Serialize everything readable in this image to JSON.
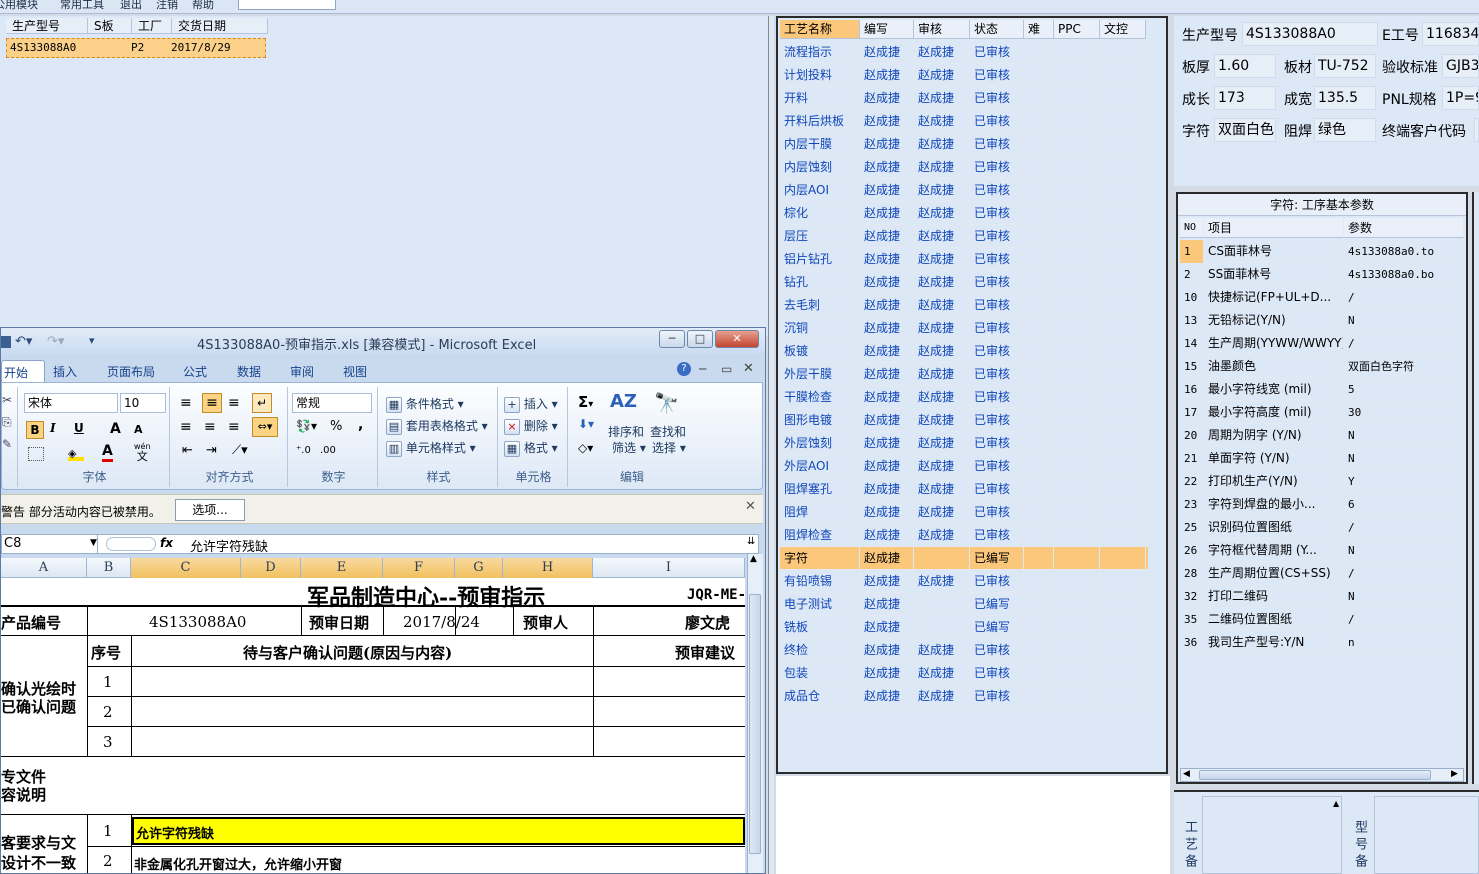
{
  "menubar": {
    "items": [
      "公用模块",
      "常用工具",
      "退出",
      "注销",
      "帮助"
    ]
  },
  "orders": {
    "headers": [
      "生产型号",
      "S板",
      "工厂",
      "交货日期"
    ],
    "rows": [
      {
        "model": "4S133088A0",
        "s_board": "",
        "factory": "P2",
        "date": "2017/8/29"
      }
    ]
  },
  "excel": {
    "title": "4S133088A0-预审指示.xls  [兼容模式] - Microsoft Excel",
    "tabs": [
      "开始",
      "插入",
      "页面布局",
      "公式",
      "数据",
      "审阅",
      "视图"
    ],
    "ribbon": {
      "font_name": "宋体",
      "font_size": "10",
      "number_format": "常规",
      "bold": "B",
      "italic": "I",
      "underline": "U",
      "font_grow": "A",
      "font_shrink": "A",
      "font_color": "A",
      "wen": "wén",
      "wen_char": "文",
      "percent": "%",
      "comma": ",",
      "sigma": "Σ",
      "conditional_format": "条件格式",
      "table_format": "套用表格格式",
      "cell_style": "单元格样式",
      "insert": "插入",
      "delete": "删除",
      "format": "格式",
      "sort": "排序和",
      "filter": "筛选",
      "find": "查找和",
      "select": "选择",
      "groups": [
        "字体",
        "对齐方式",
        "数字",
        "样式",
        "单元格",
        "编辑"
      ]
    },
    "security": {
      "warning": "警告   部分活动内容已被禁用。",
      "options": "选项..."
    },
    "namebox": "C8",
    "fx": "fx",
    "formula": "允许字符残缺",
    "columns": [
      "A",
      "B",
      "C",
      "D",
      "E",
      "F",
      "G",
      "H",
      "I"
    ],
    "sheet": {
      "title": "军品制造中心--预审指示",
      "code": "JQR-ME-",
      "product_label": "产品编号",
      "product_value": "4S133088A0",
      "date_label": "预审日期",
      "date_value": "2017/8/24",
      "reviewer_label": "预审人",
      "reviewer_value": "廖文虎",
      "seq_header": "序号",
      "issue_header": "待与客户确认问题(原因与内容)",
      "suggest_header": "预审建议",
      "section1_label_1": "确认光绘时",
      "section1_label_2": "已确认问题",
      "rows1": [
        "1",
        "2",
        "3"
      ],
      "section2_label_1": "专文件",
      "section2_label_2": "容说明",
      "section3_label_1": "客要求与文",
      "section3_label_2": "设计不一致",
      "row3_1_no": "1",
      "row3_1_text": "允许字符残缺",
      "row3_2_no": "2",
      "row3_2_text": "非金属化孔开窗过大，允许缩小开窗"
    }
  },
  "process": {
    "headers": [
      "工艺名称",
      "编写",
      "审核",
      "状态",
      "难",
      "PPC",
      "文控"
    ],
    "rows": [
      {
        "name": "流程指示",
        "writer": "赵成捷",
        "reviewer": "赵成捷",
        "status": "已审核"
      },
      {
        "name": "计划投料",
        "writer": "赵成捷",
        "reviewer": "赵成捷",
        "status": "已审核"
      },
      {
        "name": "开料",
        "writer": "赵成捷",
        "reviewer": "赵成捷",
        "status": "已审核"
      },
      {
        "name": "开料后烘板",
        "writer": "赵成捷",
        "reviewer": "赵成捷",
        "status": "已审核"
      },
      {
        "name": "内层干膜",
        "writer": "赵成捷",
        "reviewer": "赵成捷",
        "status": "已审核"
      },
      {
        "name": "内层蚀刻",
        "writer": "赵成捷",
        "reviewer": "赵成捷",
        "status": "已审核"
      },
      {
        "name": "内层AOI",
        "writer": "赵成捷",
        "reviewer": "赵成捷",
        "status": "已审核"
      },
      {
        "name": "棕化",
        "writer": "赵成捷",
        "reviewer": "赵成捷",
        "status": "已审核"
      },
      {
        "name": "层压",
        "writer": "赵成捷",
        "reviewer": "赵成捷",
        "status": "已审核"
      },
      {
        "name": "铝片钻孔",
        "writer": "赵成捷",
        "reviewer": "赵成捷",
        "status": "已审核"
      },
      {
        "name": "钻孔",
        "writer": "赵成捷",
        "reviewer": "赵成捷",
        "status": "已审核"
      },
      {
        "name": "去毛刺",
        "writer": "赵成捷",
        "reviewer": "赵成捷",
        "status": "已审核"
      },
      {
        "name": "沉铜",
        "writer": "赵成捷",
        "reviewer": "赵成捷",
        "status": "已审核"
      },
      {
        "name": "板镀",
        "writer": "赵成捷",
        "reviewer": "赵成捷",
        "status": "已审核"
      },
      {
        "name": "外层干膜",
        "writer": "赵成捷",
        "reviewer": "赵成捷",
        "status": "已审核"
      },
      {
        "name": "干膜检查",
        "writer": "赵成捷",
        "reviewer": "赵成捷",
        "status": "已审核"
      },
      {
        "name": "图形电镀",
        "writer": "赵成捷",
        "reviewer": "赵成捷",
        "status": "已审核"
      },
      {
        "name": "外层蚀刻",
        "writer": "赵成捷",
        "reviewer": "赵成捷",
        "status": "已审核"
      },
      {
        "name": "外层AOI",
        "writer": "赵成捷",
        "reviewer": "赵成捷",
        "status": "已审核"
      },
      {
        "name": "阻焊塞孔",
        "writer": "赵成捷",
        "reviewer": "赵成捷",
        "status": "已审核"
      },
      {
        "name": "阻焊",
        "writer": "赵成捷",
        "reviewer": "赵成捷",
        "status": "已审核"
      },
      {
        "name": "阻焊检查",
        "writer": "赵成捷",
        "reviewer": "赵成捷",
        "status": "已审核"
      },
      {
        "name": "字符",
        "writer": "赵成捷",
        "reviewer": "",
        "status": "已编写"
      },
      {
        "name": "有铅喷锡",
        "writer": "赵成捷",
        "reviewer": "赵成捷",
        "status": "已审核"
      },
      {
        "name": "电子测试",
        "writer": "赵成捷",
        "reviewer": "",
        "status": "已编写"
      },
      {
        "name": "铣板",
        "writer": "赵成捷",
        "reviewer": "",
        "status": "已编写"
      },
      {
        "name": "终检",
        "writer": "赵成捷",
        "reviewer": "赵成捷",
        "status": "已审核"
      },
      {
        "name": "包装",
        "writer": "赵成捷",
        "reviewer": "赵成捷",
        "status": "已审核"
      },
      {
        "name": "成品仓",
        "writer": "赵成捷",
        "reviewer": "赵成捷",
        "status": "已审核"
      }
    ]
  },
  "info": {
    "model_label": "生产型号",
    "model_value": "4S133088A0",
    "eno_label": "E工号",
    "eno_value": "116834",
    "thick_label": "板厚",
    "thick_value": "1.60",
    "material_label": "板材",
    "material_value": "TU-752",
    "std_label": "验收标准",
    "std_value": "GJB3",
    "length_label": "成长",
    "length_value": "173",
    "width_label": "成宽",
    "width_value": "135.5",
    "pnl_label": "PNL规格",
    "pnl_value": "1P=9",
    "char_label": "字符",
    "char_value": "双面白色",
    "mask_label": "阻焊",
    "mask_value": "绿色",
    "cust_label": "终端客户代码"
  },
  "params": {
    "title": "字符: 工序基本参数",
    "headers": [
      "NO",
      "项目",
      "参数"
    ],
    "rows": [
      {
        "no": "1",
        "item": "CS面菲林号",
        "value": "4s133088a0.to"
      },
      {
        "no": "2",
        "item": "SS面菲林号",
        "value": "4s133088a0.bo"
      },
      {
        "no": "10",
        "item": "快捷标记(FP+UL+D...",
        "value": "/"
      },
      {
        "no": "13",
        "item": "无铅标记(Y/N)",
        "value": "N"
      },
      {
        "no": "14",
        "item": "生产周期(YYWW/WWYY)",
        "value": "/"
      },
      {
        "no": "15",
        "item": "油墨颜色",
        "value": "双面白色字符"
      },
      {
        "no": "16",
        "item": "最小字符线宽 (mil)",
        "value": "5"
      },
      {
        "no": "17",
        "item": "最小字符高度 (mil)",
        "value": "30"
      },
      {
        "no": "20",
        "item": "周期为阴字 (Y/N)",
        "value": "N"
      },
      {
        "no": "21",
        "item": "单面字符 (Y/N)",
        "value": "N"
      },
      {
        "no": "22",
        "item": "打印机生产(Y/N)",
        "value": "Y"
      },
      {
        "no": "23",
        "item": "字符到焊盘的最小...",
        "value": "6"
      },
      {
        "no": "25",
        "item": "识别码位置图纸",
        "value": "/"
      },
      {
        "no": "26",
        "item": "字符框代替周期 (Y...",
        "value": "N"
      },
      {
        "no": "28",
        "item": "生产周期位置(CS+SS)",
        "value": "/"
      },
      {
        "no": "32",
        "item": "打印二维码",
        "value": "N"
      },
      {
        "no": "35",
        "item": "二维码位置图纸",
        "value": "/"
      },
      {
        "no": "36",
        "item": "我司生产型号:Y/N",
        "value": "n"
      }
    ]
  },
  "bottom": {
    "left_vertical": "工艺备",
    "right_vertical": "型号备"
  },
  "colors": {
    "selected_row": "#fbc77a",
    "highlight_cell": "#ffff00",
    "link_text": "#1046b8"
  }
}
